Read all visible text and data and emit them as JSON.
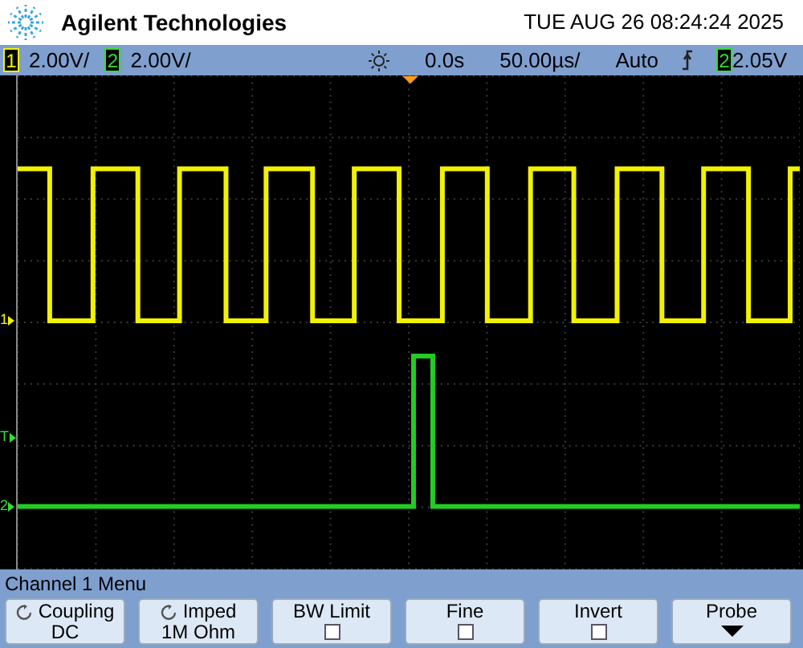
{
  "header": {
    "brand": "Agilent Technologies",
    "datetime": "TUE AUG 26 08:24:24 2025"
  },
  "status_bar": {
    "channels": [
      {
        "number": "1",
        "scale": "2.00V/",
        "color": "#f2f200"
      },
      {
        "number": "2",
        "scale": "2.00V/",
        "color": "#33dd33"
      }
    ],
    "delay": "0.0s",
    "timebase": "50.00µs/",
    "mode": "Auto",
    "trigger_source": {
      "number": "2",
      "color": "#33dd33"
    },
    "trigger_level": "2.05V"
  },
  "markers": [
    {
      "label": "1",
      "color": "#f2f200"
    },
    {
      "label": "T",
      "color": "#33dd33"
    },
    {
      "label": "2",
      "color": "#33dd33"
    }
  ],
  "menu": {
    "title": "Channel 1  Menu",
    "softkeys": [
      {
        "kind": "value",
        "label": "Coupling",
        "value": "DC"
      },
      {
        "kind": "value",
        "label": "Imped",
        "value": "1M Ohm"
      },
      {
        "kind": "checkbox",
        "label": "BW Limit",
        "checked": false
      },
      {
        "kind": "checkbox",
        "label": "Fine",
        "checked": false
      },
      {
        "kind": "checkbox",
        "label": "Invert",
        "checked": false
      },
      {
        "kind": "more",
        "label": "Probe"
      }
    ]
  }
}
